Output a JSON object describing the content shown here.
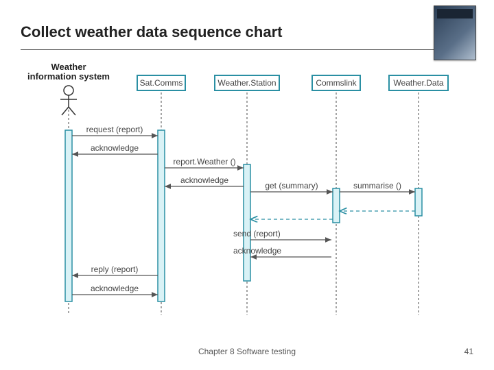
{
  "slide": {
    "title": "Collect weather data sequence chart",
    "footer_center": "Chapter 8 Software testing",
    "page_number": "41"
  },
  "actors": {
    "wis": {
      "line1": "Weather",
      "line2": "information system"
    },
    "sat": "Sat.Comms",
    "ws": "Weather.Station",
    "cl": "Commslink",
    "wd": "Weather.Data"
  },
  "msgs": {
    "m1": "request (report)",
    "m2": "acknowledge",
    "m3": "report.Weather ()",
    "m4": "acknowledge",
    "m5": "get (summary)",
    "m6": "summarise ()",
    "m7": "send (report)",
    "m8": "acknowledge",
    "m9": "reply (report)",
    "m10": "acknowledge"
  },
  "chart_data": {
    "type": "sequence-diagram",
    "title": "Collect weather data sequence chart",
    "participants": [
      {
        "id": "WIS",
        "name": "Weather information system",
        "kind": "actor"
      },
      {
        "id": "SAT",
        "name": "Sat.Comms",
        "kind": "object"
      },
      {
        "id": "WS",
        "name": "Weather.Station",
        "kind": "object"
      },
      {
        "id": "CL",
        "name": "Commslink",
        "kind": "object"
      },
      {
        "id": "WD",
        "name": "Weather.Data",
        "kind": "object"
      }
    ],
    "messages": [
      {
        "from": "WIS",
        "to": "SAT",
        "label": "request (report)",
        "type": "call"
      },
      {
        "from": "SAT",
        "to": "WIS",
        "label": "acknowledge",
        "type": "call"
      },
      {
        "from": "SAT",
        "to": "WS",
        "label": "report.Weather ()",
        "type": "call"
      },
      {
        "from": "WS",
        "to": "SAT",
        "label": "acknowledge",
        "type": "call"
      },
      {
        "from": "WS",
        "to": "CL",
        "label": "get (summary)",
        "type": "call"
      },
      {
        "from": "CL",
        "to": "WD",
        "label": "summarise ()",
        "type": "call"
      },
      {
        "from": "WD",
        "to": "CL",
        "label": "",
        "type": "return"
      },
      {
        "from": "CL",
        "to": "WS",
        "label": "",
        "type": "return"
      },
      {
        "from": "WS",
        "to": "CL",
        "label": "send (report)",
        "type": "call"
      },
      {
        "from": "CL",
        "to": "WS",
        "label": "acknowledge",
        "type": "call"
      },
      {
        "from": "SAT",
        "to": "WIS",
        "label": "reply (report)",
        "type": "call"
      },
      {
        "from": "WIS",
        "to": "SAT",
        "label": "acknowledge",
        "type": "call"
      }
    ]
  }
}
